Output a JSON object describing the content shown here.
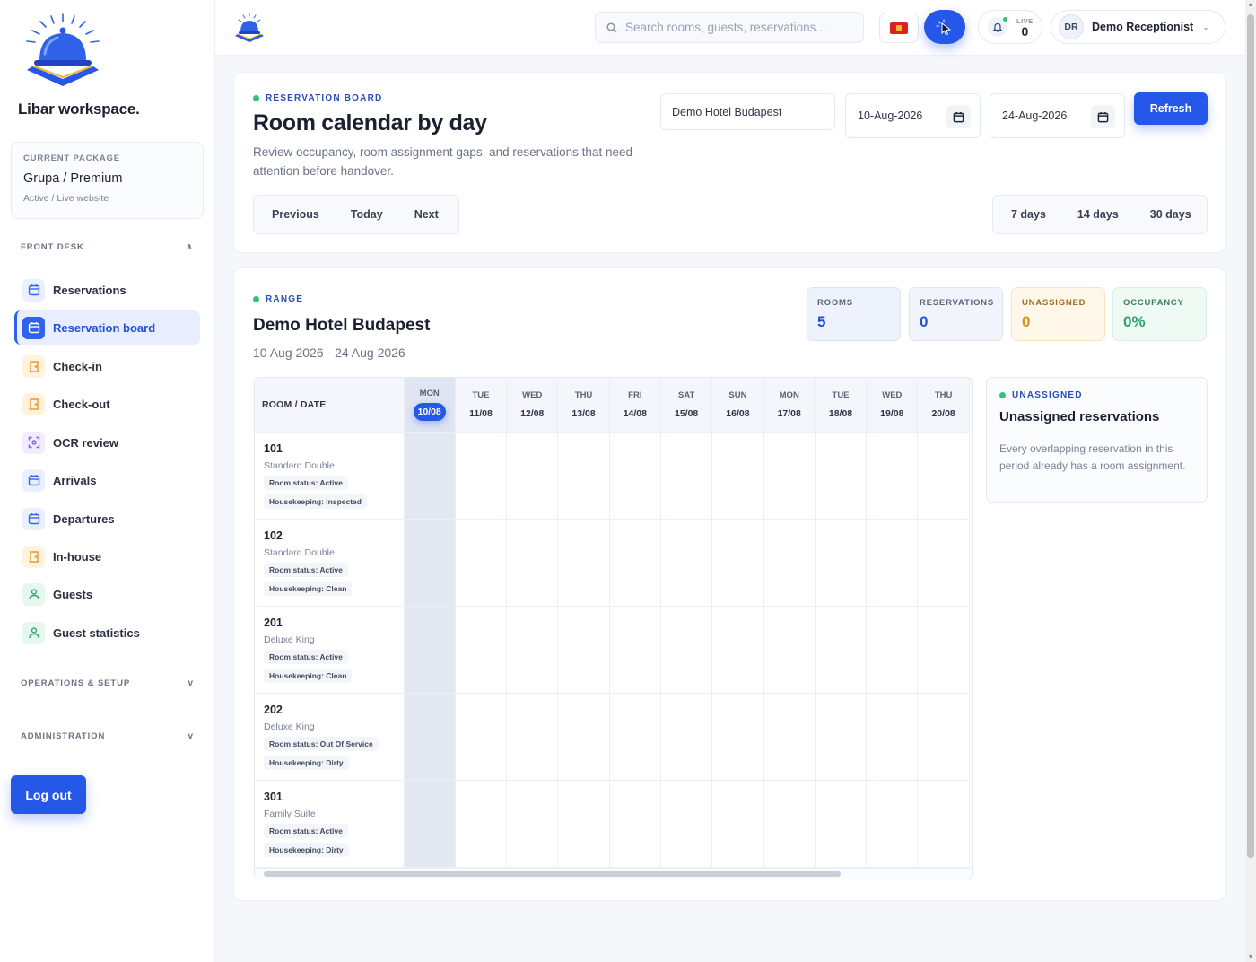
{
  "sidebar": {
    "brand": "Libar workspace.",
    "package": {
      "label": "CURRENT PACKAGE",
      "value": "Grupa / Premium",
      "status": "Active / Live website"
    },
    "sections": [
      {
        "label": "FRONT DESK",
        "chevron": "∧"
      },
      {
        "label": "OPERATIONS & SETUP",
        "chevron": "v"
      },
      {
        "label": "ADMINISTRATION",
        "chevron": "v"
      }
    ],
    "items": [
      {
        "label": "Reservations",
        "icon": "calendar-icon"
      },
      {
        "label": "Reservation board",
        "icon": "calendar-icon"
      },
      {
        "label": "Check-in",
        "icon": "door-icon"
      },
      {
        "label": "Check-out",
        "icon": "door-icon"
      },
      {
        "label": "OCR review",
        "icon": "scan-icon"
      },
      {
        "label": "Arrivals",
        "icon": "calendar-icon"
      },
      {
        "label": "Departures",
        "icon": "calendar-icon"
      },
      {
        "label": "In-house",
        "icon": "door-icon"
      },
      {
        "label": "Guests",
        "icon": "user-icon"
      },
      {
        "label": "Guest statistics",
        "icon": "user-icon"
      }
    ],
    "logout": "Log out"
  },
  "topbar": {
    "search_placeholder": "Search rooms, guests, reservations...",
    "live_label": "LIVE",
    "live_count": "0",
    "user_initials": "DR",
    "user_name": "Demo Receptionist",
    "user_chevron": "⌄"
  },
  "board": {
    "eyebrow": "RESERVATION BOARD",
    "title": "Room calendar by day",
    "description": "Review occupancy, room assignment gaps, and reservations that need attention before handover.",
    "hotel": "Demo Hotel Budapest",
    "date_from": "10-Aug-2026",
    "date_to": "24-Aug-2026",
    "refresh": "Refresh",
    "nav": [
      "Previous",
      "Today",
      "Next"
    ],
    "spans": [
      "7 days",
      "14 days",
      "30 days"
    ]
  },
  "range": {
    "eyebrow": "RANGE",
    "hotel": "Demo Hotel Budapest",
    "period": "10 Aug 2026 - 24 Aug 2026",
    "stats": [
      {
        "label": "ROOMS",
        "value": "5"
      },
      {
        "label": "RESERVATIONS",
        "value": "0"
      },
      {
        "label": "UNASSIGNED",
        "value": "0"
      },
      {
        "label": "OCCUPANCY",
        "value": "0%"
      }
    ],
    "grid_header": "ROOM / DATE",
    "days": [
      {
        "dow": "MON",
        "date": "10/08"
      },
      {
        "dow": "TUE",
        "date": "11/08"
      },
      {
        "dow": "WED",
        "date": "12/08"
      },
      {
        "dow": "THU",
        "date": "13/08"
      },
      {
        "dow": "FRI",
        "date": "14/08"
      },
      {
        "dow": "SAT",
        "date": "15/08"
      },
      {
        "dow": "SUN",
        "date": "16/08"
      },
      {
        "dow": "MON",
        "date": "17/08"
      },
      {
        "dow": "TUE",
        "date": "18/08"
      },
      {
        "dow": "WED",
        "date": "19/08"
      },
      {
        "dow": "THU",
        "date": "20/08"
      }
    ],
    "rooms": [
      {
        "number": "101",
        "type": "Standard Double",
        "status": "Room status: Active",
        "housekeeping": "Housekeeping: Inspected"
      },
      {
        "number": "102",
        "type": "Standard Double",
        "status": "Room status: Active",
        "housekeeping": "Housekeeping: Clean"
      },
      {
        "number": "201",
        "type": "Deluxe King",
        "status": "Room status: Active",
        "housekeeping": "Housekeeping: Clean"
      },
      {
        "number": "202",
        "type": "Deluxe King",
        "status": "Room status: Out Of Service",
        "housekeeping": "Housekeeping: Dirty"
      },
      {
        "number": "301",
        "type": "Family Suite",
        "status": "Room status: Active",
        "housekeeping": "Housekeeping: Dirty"
      }
    ]
  },
  "unassigned": {
    "eyebrow": "UNASSIGNED",
    "title": "Unassigned reservations",
    "description": "Every overlapping reservation in this period already has a room assignment."
  }
}
